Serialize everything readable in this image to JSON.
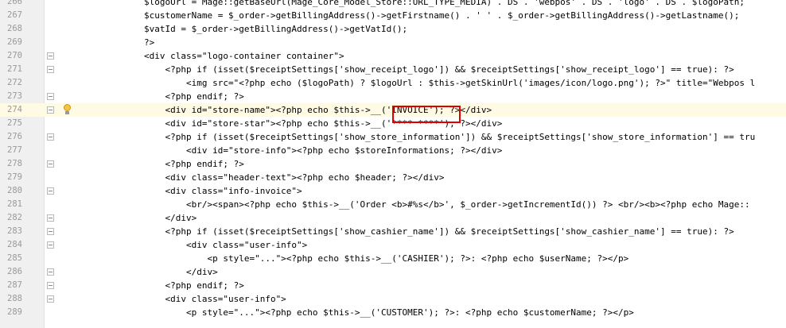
{
  "editor": {
    "lines": [
      {
        "num": "266",
        "text": "$logoUrl = Mage::getBaseUrl(Mage_Core_Model_Store::URL_TYPE_MEDIA) . DS . 'webpos' . DS . 'logo' . DS . $logoPath;"
      },
      {
        "num": "267",
        "text": "$customerName = $_order->getBillingAddress()->getFirstname() . ' ' . $_order->getBillingAddress()->getLastname();"
      },
      {
        "num": "268",
        "text": "$vatId = $_order->getBillingAddress()->getVatId();"
      },
      {
        "num": "269",
        "text": "?>"
      },
      {
        "num": "270",
        "text": "<div class=\"logo-container container\">"
      },
      {
        "num": "271",
        "text": "    <?php if (isset($receiptSettings['show_receipt_logo']) && $receiptSettings['show_receipt_logo'] == true): ?>"
      },
      {
        "num": "272",
        "text": "        <img src=\"<?php echo ($logoPath) ? $logoUrl : $this->getSkinUrl('images/icon/logo.png'); ?>\" title=\"Webpos l"
      },
      {
        "num": "273",
        "text": "    <?php endif; ?>"
      },
      {
        "num": "274",
        "text": "    <div id=\"store-name\"><?php echo $this->__('INVOICE'); ?></div>"
      },
      {
        "num": "275",
        "text": "    <div id=\"store-star\"><?php echo $this->__('**** ****'); ?></div>"
      },
      {
        "num": "276",
        "text": "    <?php if (isset($receiptSettings['show_store_information']) && $receiptSettings['show_store_information'] == tru"
      },
      {
        "num": "277",
        "text": "        <div id=\"store-info\"><?php echo $storeInformations; ?></div>"
      },
      {
        "num": "278",
        "text": "    <?php endif; ?>"
      },
      {
        "num": "279",
        "text": "    <div class=\"header-text\"><?php echo $header; ?></div>"
      },
      {
        "num": "280",
        "text": "    <div class=\"info-invoice\">"
      },
      {
        "num": "281",
        "text": "        <br/><span><?php echo $this->__('Order <b>#%s</b>', $_order->getIncrementId()) ?> <br/><b><?php echo Mage::"
      },
      {
        "num": "282",
        "text": "    </div>"
      },
      {
        "num": "283",
        "text": "    <?php if (isset($receiptSettings['show_cashier_name']) && $receiptSettings['show_cashier_name'] == true): ?>"
      },
      {
        "num": "284",
        "text": "        <div class=\"user-info\">"
      },
      {
        "num": "285",
        "text": "            <p style=\"...\"><?php echo $this->__('CASHIER'); ?>: <?php echo $userName; ?></p>"
      },
      {
        "num": "286",
        "text": "        </div>"
      },
      {
        "num": "287",
        "text": "    <?php endif; ?>"
      },
      {
        "num": "288",
        "text": "    <div class=\"user-info\">"
      },
      {
        "num": "289",
        "text": "        <p style=\"...\"><?php echo $this->__('CUSTOMER'); ?>: <?php echo $customerName; ?></p>"
      }
    ],
    "current_line": "274",
    "highlighted_token": "('INVOICE');",
    "colors": {
      "gutter": "#f0f0f0",
      "line_number": "#999999",
      "current_line_bg": "#fffae3",
      "tag": "#000080",
      "attribute": "#0000ff",
      "string": "#008000",
      "variable": "#660e7a",
      "method_highlight": "#f5eda6",
      "annotation_box": "#e00000"
    },
    "fold_lines": [
      "270",
      "271",
      "273",
      "274",
      "276",
      "278",
      "280",
      "282",
      "283",
      "284",
      "286",
      "287",
      "288"
    ],
    "bulb_line": "274",
    "bulb_icon": "lightbulb-icon"
  }
}
